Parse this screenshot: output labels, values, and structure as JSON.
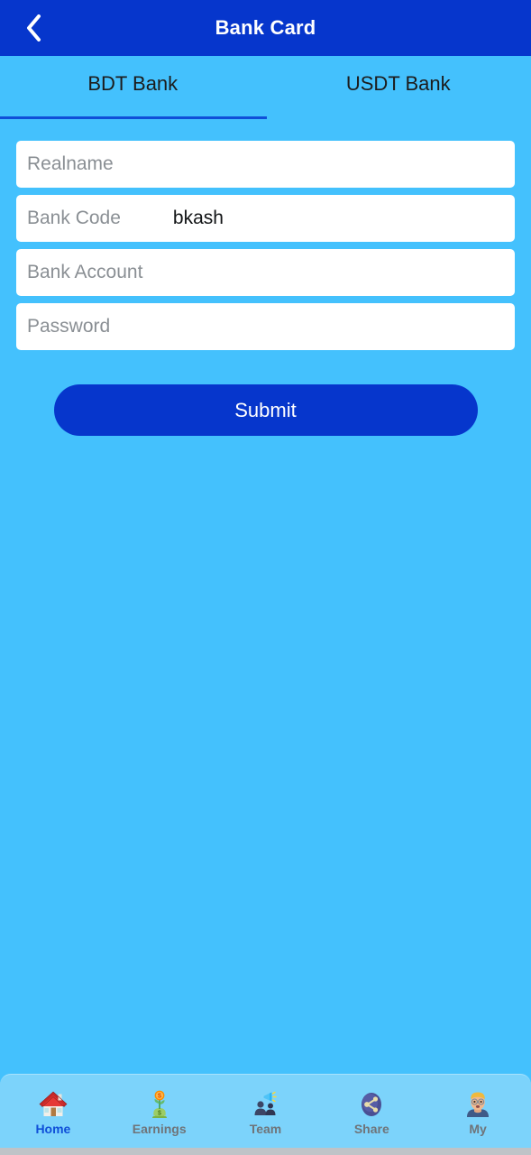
{
  "header": {
    "title": "Bank Card",
    "back_icon": "chevron-left-icon",
    "background_color": "#0636cc",
    "title_color": "#ffffff"
  },
  "page": {
    "background_color": "#44c1fd"
  },
  "tabs": {
    "active_index": 0,
    "indicator_color": "#0f4fd8",
    "items": [
      {
        "label": "BDT Bank",
        "active": true
      },
      {
        "label": "USDT Bank",
        "active": false
      }
    ]
  },
  "form": {
    "fields": [
      {
        "label": "Realname",
        "placeholder": "Realname",
        "value": "",
        "type": "text"
      },
      {
        "label": "Bank Code",
        "placeholder": "Bank Code",
        "value": "bkash",
        "type": "select"
      },
      {
        "label": "Bank Account",
        "placeholder": "Bank Account",
        "value": "",
        "type": "text"
      },
      {
        "label": "Password",
        "placeholder": "Password",
        "value": "",
        "type": "password"
      }
    ],
    "submit_label": "Submit",
    "submit_color": "#0636cc"
  },
  "bottom_nav": {
    "background_color": "#7cd3fb",
    "active_color": "#0f4fd8",
    "inactive_color": "#6f7479",
    "items": [
      {
        "label": "Home",
        "icon": "house-icon",
        "active": true
      },
      {
        "label": "Earnings",
        "icon": "money-plant-icon",
        "active": false
      },
      {
        "label": "Team",
        "icon": "people-megaphone-icon",
        "active": false
      },
      {
        "label": "Share",
        "icon": "share-network-icon",
        "active": false
      },
      {
        "label": "My",
        "icon": "person-avatar-icon",
        "active": false
      }
    ]
  }
}
